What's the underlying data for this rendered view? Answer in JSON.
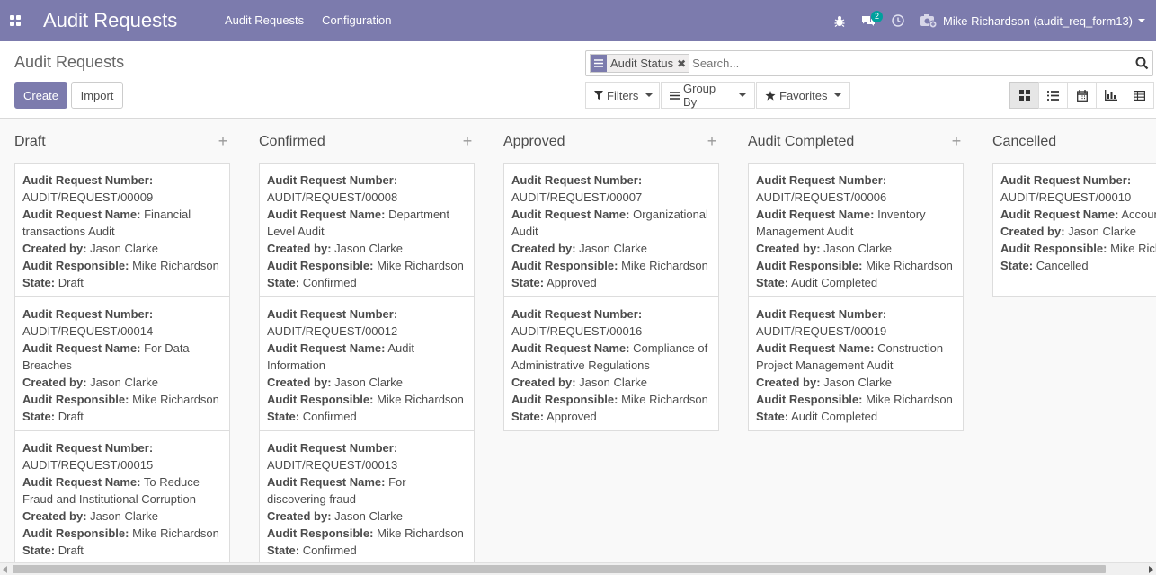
{
  "navbar": {
    "brand": "Audit Requests",
    "menu": [
      "Audit Requests",
      "Configuration"
    ],
    "chat_badge": "2",
    "user_name": "Mike Richardson (audit_req_form13)"
  },
  "control_panel": {
    "title": "Audit Requests",
    "create_label": "Create",
    "import_label": "Import",
    "facet_label": "Audit Status",
    "search_placeholder": "Search...",
    "filters_label": "Filters",
    "groupby_label": "Group By",
    "favorites_label": "Favorites"
  },
  "colors": {
    "primary": "#7c7bad",
    "badge": "#00a09d"
  },
  "labels": {
    "number": "Audit Request Number:",
    "name": "Audit Request Name:",
    "created": "Created by:",
    "responsible": "Audit Responsible:",
    "state": "State:"
  },
  "columns": [
    {
      "title": "Draft",
      "cards": [
        {
          "number": "AUDIT/REQUEST/00009",
          "name": "Financial transactions Audit",
          "created": "Jason Clarke",
          "responsible": "Mike Richardson",
          "state": "Draft"
        },
        {
          "number": "AUDIT/REQUEST/00014",
          "name": "For Data Breaches",
          "created": "Jason Clarke",
          "responsible": "Mike Richardson",
          "state": "Draft"
        },
        {
          "number": "AUDIT/REQUEST/00015",
          "name": "To Reduce Fraud and Institutional Corruption",
          "created": "Jason Clarke",
          "responsible": "Mike Richardson",
          "state": "Draft"
        }
      ]
    },
    {
      "title": "Confirmed",
      "cards": [
        {
          "number": "AUDIT/REQUEST/00008",
          "name": "Department Level Audit",
          "created": "Jason Clarke",
          "responsible": "Mike Richardson",
          "state": "Confirmed"
        },
        {
          "number": "AUDIT/REQUEST/00012",
          "name": "Audit Information",
          "created": "Jason Clarke",
          "responsible": "Mike Richardson",
          "state": "Confirmed"
        },
        {
          "number": "AUDIT/REQUEST/00013",
          "name": "For discovering fraud",
          "created": "Jason Clarke",
          "responsible": "Mike Richardson",
          "state": "Confirmed"
        }
      ]
    },
    {
      "title": "Approved",
      "cards": [
        {
          "number": "AUDIT/REQUEST/00007",
          "name": "Organizational Audit",
          "created": "Jason Clarke",
          "responsible": "Mike Richardson",
          "state": "Approved"
        },
        {
          "number": "AUDIT/REQUEST/00016",
          "name": "Compliance of Administrative Regulations",
          "created": "Jason Clarke",
          "responsible": "Mike Richardson",
          "state": "Approved"
        }
      ]
    },
    {
      "title": "Audit Completed",
      "cards": [
        {
          "number": "AUDIT/REQUEST/00006",
          "name": "Inventory Management Audit",
          "created": "Jason Clarke",
          "responsible": "Mike Richardson",
          "state": "Audit Completed"
        },
        {
          "number": "AUDIT/REQUEST/00019",
          "name": "Construction Project Management Audit",
          "created": "Jason Clarke",
          "responsible": "Mike Richardson",
          "state": "Audit Completed"
        }
      ]
    },
    {
      "title": "Cancelled",
      "cards": [
        {
          "number": "AUDIT/REQUEST/00010",
          "name": "Accounts audit",
          "created": "Jason Clarke",
          "responsible": "Mike Richardson",
          "state": "Cancelled"
        }
      ]
    }
  ]
}
